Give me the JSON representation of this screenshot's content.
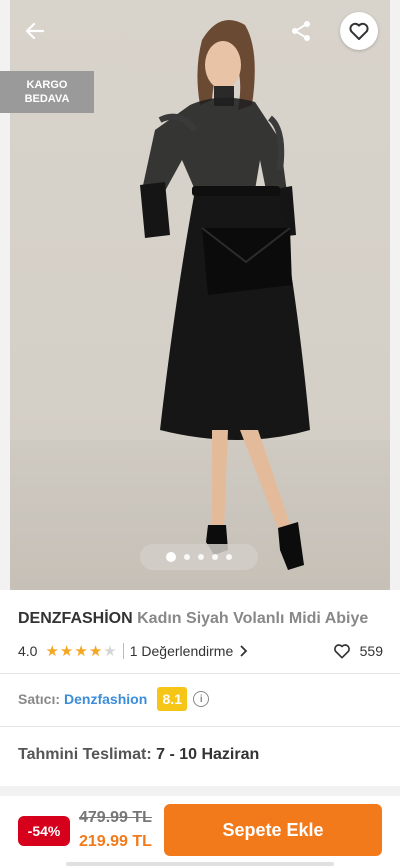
{
  "gallery": {
    "cargo_badge_line1": "KARGO",
    "cargo_badge_line2": "BEDAVA",
    "image_count": 5,
    "active_image": 1,
    "icons": {
      "back": "arrow-left-icon",
      "share": "share-icon",
      "favorite": "heart-outline-icon"
    }
  },
  "product": {
    "brand": "DENZFASHİON",
    "name": "Kadın Siyah Volanlı Midi Abiye",
    "rating": "4.0",
    "rating_value": 4,
    "rating_max": 5,
    "reviews": "1 Değerlendirme",
    "likes": "559"
  },
  "seller": {
    "label": "Satıcı:",
    "name": "Denzfashion",
    "score": "8.1"
  },
  "delivery": {
    "label": "Tahmini Teslimat:",
    "value": "7 - 10 Haziran"
  },
  "purchase": {
    "discount": "-54%",
    "old_price": "479.99 TL",
    "new_price": "219.99 TL",
    "add_to_cart": "Sepete Ekle"
  },
  "colors": {
    "accent": "#f27a1a",
    "discount": "#d6001c",
    "seller_link": "#3c8dd9",
    "score_badge": "#f5c518",
    "star": "#f5a623"
  }
}
